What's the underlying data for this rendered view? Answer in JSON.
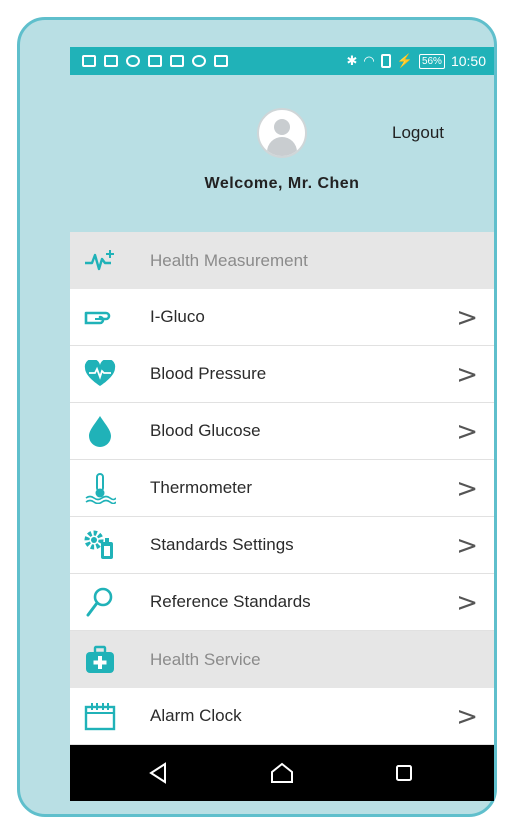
{
  "status_bar": {
    "battery": "56%",
    "time": "10:50"
  },
  "header": {
    "logout_label": "Logout",
    "welcome_text": "Welcome,  Mr. Chen"
  },
  "menu": {
    "health_measurement": "Health Measurement",
    "items": [
      {
        "label": "I-Gluco",
        "icon": "finger-icon"
      },
      {
        "label": "Blood Pressure",
        "icon": "heart-icon"
      },
      {
        "label": "Blood Glucose",
        "icon": "drop-icon"
      },
      {
        "label": "Thermometer",
        "icon": "thermometer-icon"
      },
      {
        "label": "Standards Settings",
        "icon": "gear-icon"
      },
      {
        "label": "Reference Standards",
        "icon": "search-icon"
      }
    ],
    "health_service": "Health Service",
    "service_items": [
      {
        "label": "Alarm Clock",
        "icon": "calendar-icon"
      }
    ],
    "chevron": ">"
  },
  "colors": {
    "accent": "#20b2b8",
    "background": "#b9dfe4",
    "section_bg": "#e6e6e6"
  }
}
